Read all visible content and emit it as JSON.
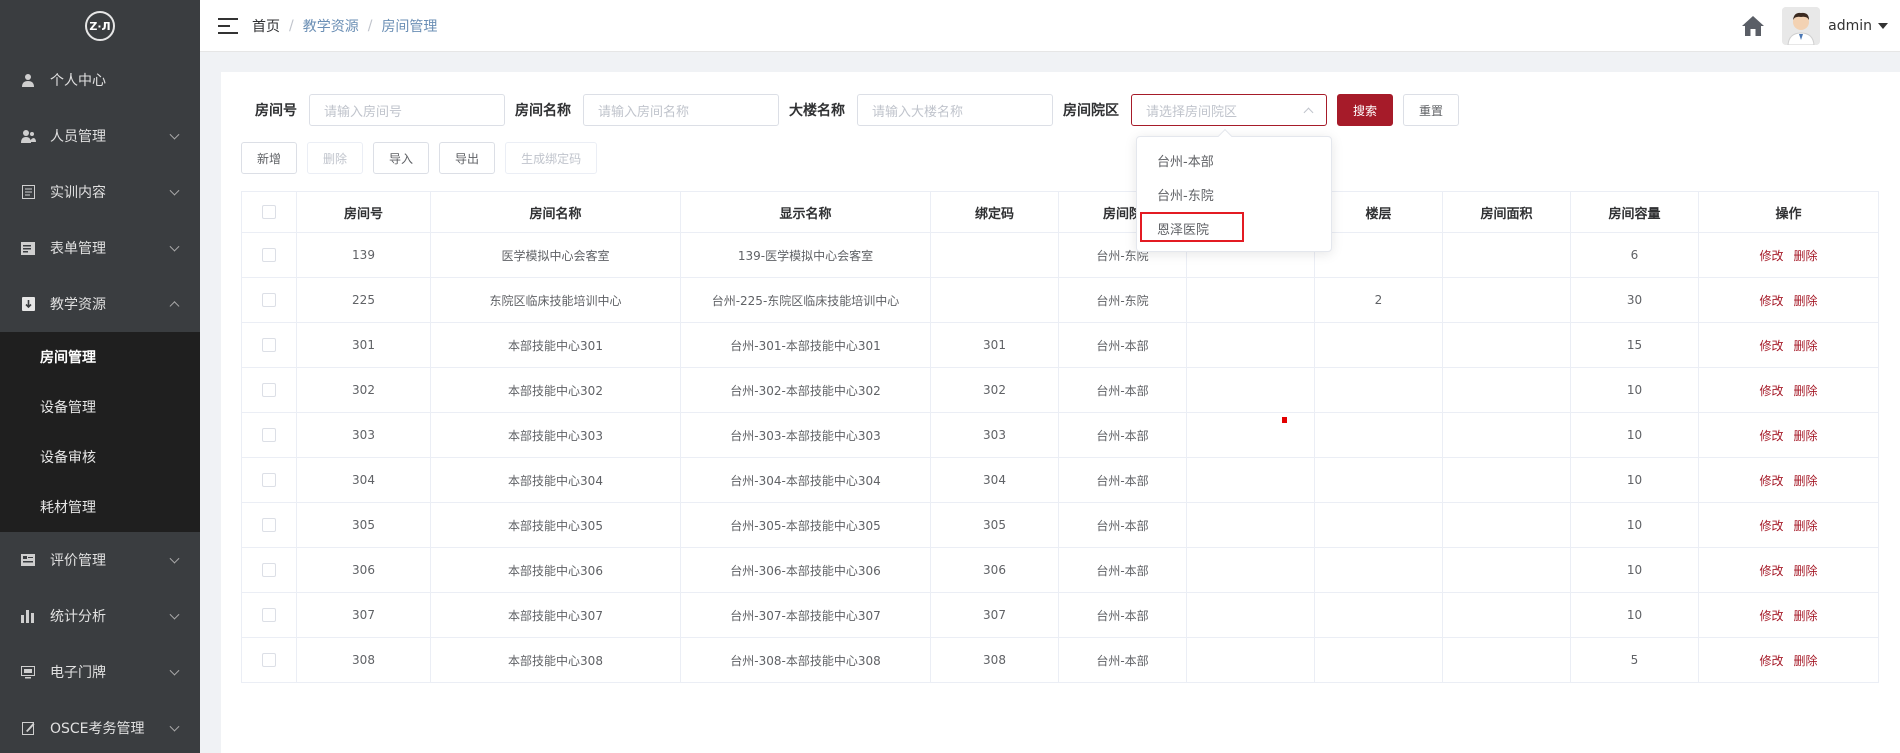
{
  "sidebar": {
    "logo_text": "Z·Л",
    "items": [
      {
        "label": "个人中心",
        "icon": "user-icon"
      },
      {
        "label": "人员管理",
        "icon": "users-icon"
      },
      {
        "label": "实训内容",
        "icon": "list-icon"
      },
      {
        "label": "表单管理",
        "icon": "form-icon"
      },
      {
        "label": "教学资源",
        "icon": "resource-icon"
      },
      {
        "label": "评价管理",
        "icon": "evaluate-icon"
      },
      {
        "label": "统计分析",
        "icon": "chart-icon"
      },
      {
        "label": "电子门牌",
        "icon": "monitor-icon"
      },
      {
        "label": "OSCE考务管理",
        "icon": "edit-icon"
      }
    ],
    "submenu": [
      "房间管理",
      "设备管理",
      "设备审核",
      "耗材管理"
    ]
  },
  "header": {
    "breadcrumb": [
      "首页",
      "教学资源",
      "房间管理"
    ],
    "separator": "/",
    "username": "admin"
  },
  "filters": {
    "room_no_label": "房间号",
    "room_no_placeholder": "请输入房间号",
    "room_name_label": "房间名称",
    "room_name_placeholder": "请输入房间名称",
    "building_label": "大楼名称",
    "building_placeholder": "请输入大楼名称",
    "campus_label": "房间院区",
    "campus_placeholder": "请选择房间院区",
    "search_label": "搜索",
    "reset_label": "重置"
  },
  "actions": {
    "add": "新增",
    "delete": "删除",
    "import": "导入",
    "export": "导出",
    "gen_code": "生成绑定码"
  },
  "dropdown": {
    "options": [
      "台州-本部",
      "台州-东院",
      "恩泽医院"
    ]
  },
  "table": {
    "headers": [
      "房间号",
      "房间名称",
      "显示名称",
      "绑定码",
      "房间院",
      "",
      "楼层",
      "房间面积",
      "房间容量",
      "操作"
    ],
    "edit_label": "修改",
    "delete_label": "删除",
    "rows": [
      {
        "no": "139",
        "name": "医学模拟中心会客室",
        "display": "139-医学模拟中心会客室",
        "code": "",
        "campus": "台州-东院",
        "building": "",
        "floor": "",
        "area": "",
        "capacity": "6"
      },
      {
        "no": "225",
        "name": "东院区临床技能培训中心",
        "display": "台州-225-东院区临床技能培训中心",
        "code": "",
        "campus": "台州-东院",
        "building": "",
        "floor": "2",
        "area": "",
        "capacity": "30"
      },
      {
        "no": "301",
        "name": "本部技能中心301",
        "display": "台州-301-本部技能中心301",
        "code": "301",
        "campus": "台州-本部",
        "building": "",
        "floor": "",
        "area": "",
        "capacity": "15"
      },
      {
        "no": "302",
        "name": "本部技能中心302",
        "display": "台州-302-本部技能中心302",
        "code": "302",
        "campus": "台州-本部",
        "building": "",
        "floor": "",
        "area": "",
        "capacity": "10"
      },
      {
        "no": "303",
        "name": "本部技能中心303",
        "display": "台州-303-本部技能中心303",
        "code": "303",
        "campus": "台州-本部",
        "building": "",
        "floor": "",
        "area": "",
        "capacity": "10"
      },
      {
        "no": "304",
        "name": "本部技能中心304",
        "display": "台州-304-本部技能中心304",
        "code": "304",
        "campus": "台州-本部",
        "building": "",
        "floor": "",
        "area": "",
        "capacity": "10"
      },
      {
        "no": "305",
        "name": "本部技能中心305",
        "display": "台州-305-本部技能中心305",
        "code": "305",
        "campus": "台州-本部",
        "building": "",
        "floor": "",
        "area": "",
        "capacity": "10"
      },
      {
        "no": "306",
        "name": "本部技能中心306",
        "display": "台州-306-本部技能中心306",
        "code": "306",
        "campus": "台州-本部",
        "building": "",
        "floor": "",
        "area": "",
        "capacity": "10"
      },
      {
        "no": "307",
        "name": "本部技能中心307",
        "display": "台州-307-本部技能中心307",
        "code": "307",
        "campus": "台州-本部",
        "building": "",
        "floor": "",
        "area": "",
        "capacity": "10"
      },
      {
        "no": "308",
        "name": "本部技能中心308",
        "display": "台州-308-本部技能中心308",
        "code": "308",
        "campus": "台州-本部",
        "building": "",
        "floor": "",
        "area": "",
        "capacity": "5"
      }
    ]
  },
  "colors": {
    "sidebar_bg": "#3a3d40",
    "submenu_bg": "#1f1f1f",
    "accent": "#a61b29",
    "highlight_box": "#e31b23"
  }
}
